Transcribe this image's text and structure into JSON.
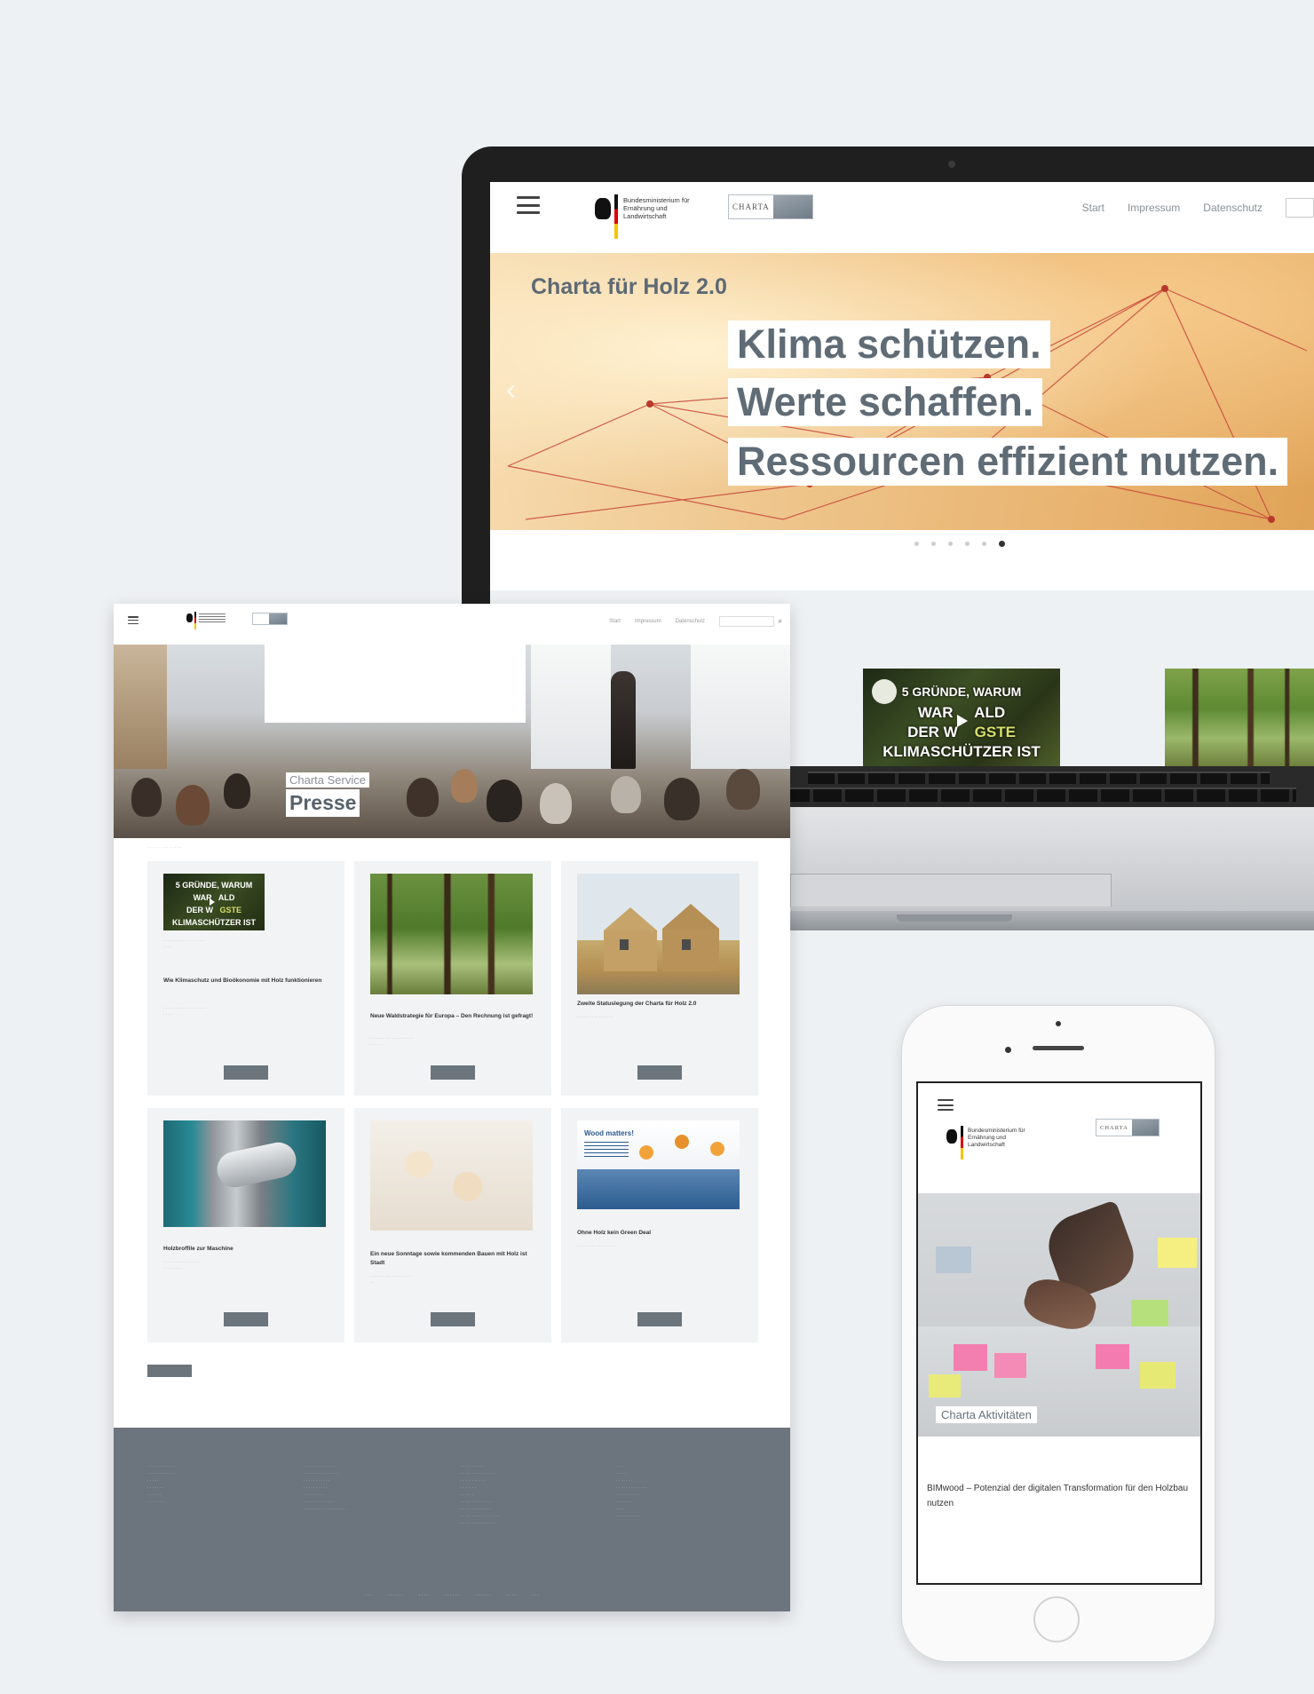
{
  "laptop": {
    "nav": [
      "Start",
      "Impressum",
      "Datenschutz"
    ],
    "ministry_logo": "Bundesministerium für Ernährung und Landwirtschaft",
    "charta_logo": "CHARTA",
    "hero": {
      "kicker": "Charta für Holz 2.0",
      "lines": [
        "Klima schützen.",
        "Werte schaffen.",
        "Ressourcen effizient nutzen."
      ],
      "slide_count": 6,
      "active_slide": 6
    },
    "video": {
      "line1": "5 GRÜNDE, WARUM",
      "line2a": "WAR",
      "line2b": "ALD",
      "line3a": "DER W",
      "line3b": "GSTE",
      "line4": "KLIMASCHÜTZER IST"
    }
  },
  "desktop": {
    "hero": {
      "kicker": "Charta Service",
      "title": "Presse"
    },
    "cards": [
      {
        "meta": "",
        "date": "",
        "title": "Wie Klimaschutz und Bioökonomie mit Holz funktionieren",
        "desc": "",
        "button": ""
      },
      {
        "meta": "",
        "date": "",
        "title": "Neue Waldstrategie für Europa – Den Rechnung ist gefragt!",
        "desc": "",
        "button": ""
      },
      {
        "meta": "",
        "date": "",
        "title": "Zweite Statuslegung der Charta für Holz 2.0",
        "desc": "",
        "button": ""
      },
      {
        "meta": "",
        "date": "",
        "title": "Holzbroffile zur Maschine",
        "desc": "",
        "button": ""
      },
      {
        "meta": "",
        "date": "",
        "title": "Ein neue Sonntage sowie kommenden Bauen mit Holz ist Stadt",
        "desc": "",
        "button": ""
      },
      {
        "meta": "",
        "date": "",
        "title": "Ohne Holz kein Green Deal",
        "desc": "",
        "button": ""
      }
    ],
    "globe_caption": "Wood matters!",
    "footer_columns": [
      {
        "heading": "",
        "links": []
      },
      {
        "heading": "",
        "links": []
      },
      {
        "heading": "",
        "links": []
      },
      {
        "heading": "",
        "links": []
      }
    ],
    "footer_bottom": []
  },
  "phone": {
    "ministry_logo": "Bundesministerium für Ernährung und Landwirtschaft",
    "charta_logo": "CHARTA",
    "photo_label": "Charta Aktivitäten",
    "breadcrumb": "",
    "date": "",
    "title": "BIMwood – Potenzial der digitalen Transformation für den Holzbau nutzen",
    "desc": ""
  },
  "colors": {
    "page_bg": "#eef1f4",
    "hero_text": "#5f6b75",
    "button_grey": "#6c747c",
    "footer_grey": "#6c747e",
    "accent_green": "#7aa33a"
  }
}
